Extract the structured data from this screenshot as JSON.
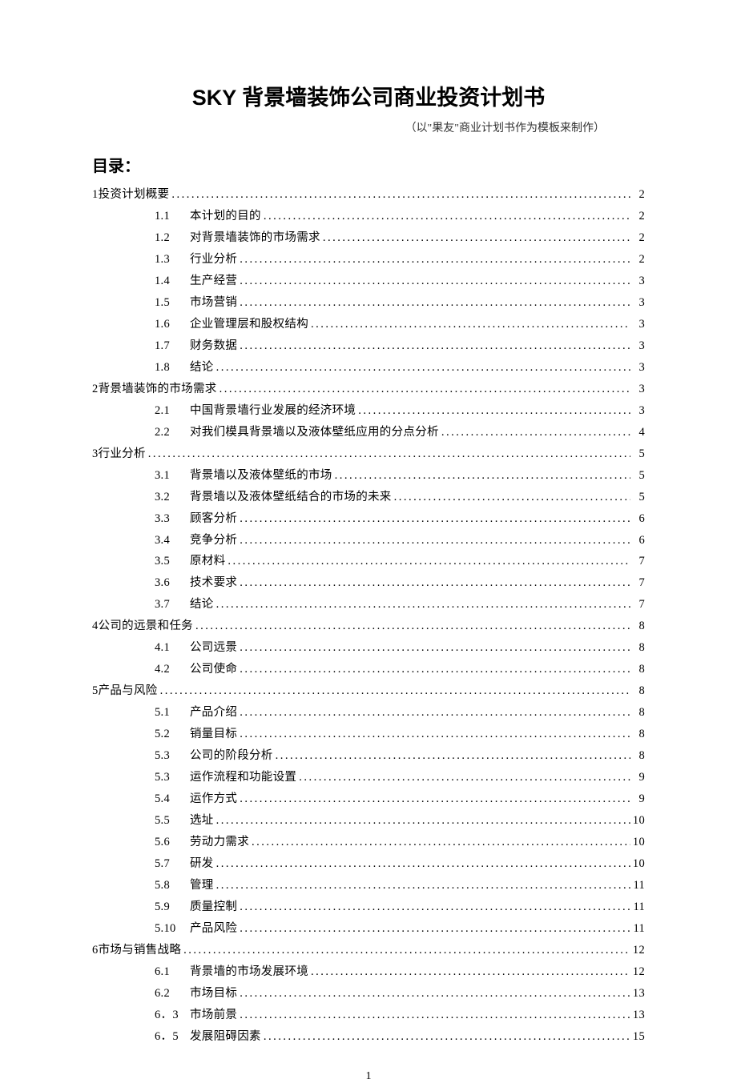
{
  "title": "SKY 背景墙装饰公司商业投资计划书",
  "subtitle": "（以\"果友\"商业计划书作为模板来制作）",
  "tocHeading": "目录：",
  "pageNumber": "1",
  "toc": [
    {
      "level": 0,
      "num": "1",
      "label": "投资计划概要",
      "page": "2"
    },
    {
      "level": 1,
      "num": "1.1",
      "label": "本计划的目的",
      "page": "2"
    },
    {
      "level": 1,
      "num": "1.2",
      "label": "对背景墙装饰的市场需求",
      "page": "2"
    },
    {
      "level": 1,
      "num": "1.3",
      "label": "行业分析",
      "page": "2"
    },
    {
      "level": 1,
      "num": "1.4",
      "label": "生产经营",
      "page": "3"
    },
    {
      "level": 1,
      "num": "1.5",
      "label": "市场营销",
      "page": "3"
    },
    {
      "level": 1,
      "num": "1.6",
      "label": "企业管理层和股权结构",
      "page": "3"
    },
    {
      "level": 1,
      "num": "1.7",
      "label": "财务数据",
      "page": "3"
    },
    {
      "level": 1,
      "num": "1.8",
      "label": "结论",
      "page": "3"
    },
    {
      "level": 0,
      "num": "2",
      "label": "背景墙装饰的市场需求",
      "page": "3"
    },
    {
      "level": 1,
      "num": "2.1",
      "label": "中国背景墙行业发展的经济环境",
      "page": "3"
    },
    {
      "level": 1,
      "num": "2.2",
      "label": "对我们模具背景墙以及液体壁纸应用的分点分析",
      "page": "4"
    },
    {
      "level": 0,
      "num": "3",
      "label": "行业分析",
      "page": "5"
    },
    {
      "level": 1,
      "num": "3.1",
      "label": "背景墙以及液体壁纸的市场",
      "page": "5"
    },
    {
      "level": 1,
      "num": "3.2",
      "label": "背景墙以及液体壁纸结合的市场的未来",
      "page": "5"
    },
    {
      "level": 1,
      "num": "3.3",
      "label": "顾客分析",
      "page": "6"
    },
    {
      "level": 1,
      "num": "3.4",
      "label": "竞争分析",
      "page": "6"
    },
    {
      "level": 1,
      "num": "3.5",
      "label": "原材料",
      "page": "7"
    },
    {
      "level": 1,
      "num": "3.6",
      "label": "技术要求",
      "page": "7"
    },
    {
      "level": 1,
      "num": "3.7",
      "label": "结论",
      "page": "7"
    },
    {
      "level": 0,
      "num": "4",
      "label": "公司的远景和任务",
      "page": "8"
    },
    {
      "level": 1,
      "num": "4.1",
      "label": "公司远景",
      "page": "8"
    },
    {
      "level": 1,
      "num": "4.2",
      "label": "公司使命",
      "page": "8"
    },
    {
      "level": 0,
      "num": "5",
      "label": "产品与风险",
      "page": "8"
    },
    {
      "level": 1,
      "num": "5.1",
      "label": "产品介绍",
      "page": "8"
    },
    {
      "level": 1,
      "num": "5.2",
      "label": "销量目标",
      "page": "8"
    },
    {
      "level": 1,
      "num": "5.3",
      "label": "公司的阶段分析",
      "page": "8"
    },
    {
      "level": 1,
      "num": "5.3",
      "label": "运作流程和功能设置",
      "page": "9"
    },
    {
      "level": 1,
      "num": "5.4",
      "label": "运作方式",
      "page": "9"
    },
    {
      "level": 1,
      "num": "5.5",
      "label": "选址",
      "page": "10"
    },
    {
      "level": 1,
      "num": "5.6",
      "label": "劳动力需求",
      "page": "10"
    },
    {
      "level": 1,
      "num": "5.7",
      "label": "研发",
      "page": "10"
    },
    {
      "level": 1,
      "num": "5.8",
      "label": "管理",
      "page": "11"
    },
    {
      "level": 1,
      "num": "5.9",
      "label": "质量控制",
      "page": "11"
    },
    {
      "level": 1,
      "num": "5.10",
      "label": "产品风险",
      "page": "11"
    },
    {
      "level": 0,
      "num": "6",
      "label": "市场与销售战略",
      "page": "12"
    },
    {
      "level": 1,
      "num": "6.1",
      "label": "背景墙的市场发展环境",
      "page": "12"
    },
    {
      "level": 1,
      "num": "6.2",
      "label": "市场目标",
      "page": "13"
    },
    {
      "level": 1,
      "num": "6．3",
      "label": "市场前景",
      "page": "13"
    },
    {
      "level": 1,
      "num": "6．5",
      "label": "发展阻碍因素",
      "page": "15"
    }
  ]
}
